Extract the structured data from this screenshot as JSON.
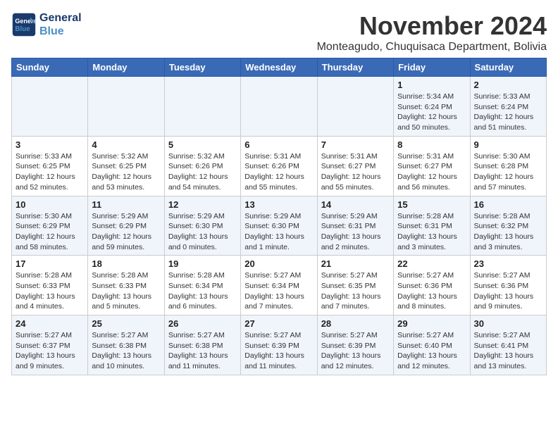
{
  "header": {
    "logo_line1": "General",
    "logo_line2": "Blue",
    "month": "November 2024",
    "location": "Monteagudo, Chuquisaca Department, Bolivia"
  },
  "weekdays": [
    "Sunday",
    "Monday",
    "Tuesday",
    "Wednesday",
    "Thursday",
    "Friday",
    "Saturday"
  ],
  "weeks": [
    [
      {
        "day": "",
        "info": ""
      },
      {
        "day": "",
        "info": ""
      },
      {
        "day": "",
        "info": ""
      },
      {
        "day": "",
        "info": ""
      },
      {
        "day": "",
        "info": ""
      },
      {
        "day": "1",
        "info": "Sunrise: 5:34 AM\nSunset: 6:24 PM\nDaylight: 12 hours and 50 minutes."
      },
      {
        "day": "2",
        "info": "Sunrise: 5:33 AM\nSunset: 6:24 PM\nDaylight: 12 hours and 51 minutes."
      }
    ],
    [
      {
        "day": "3",
        "info": "Sunrise: 5:33 AM\nSunset: 6:25 PM\nDaylight: 12 hours and 52 minutes."
      },
      {
        "day": "4",
        "info": "Sunrise: 5:32 AM\nSunset: 6:25 PM\nDaylight: 12 hours and 53 minutes."
      },
      {
        "day": "5",
        "info": "Sunrise: 5:32 AM\nSunset: 6:26 PM\nDaylight: 12 hours and 54 minutes."
      },
      {
        "day": "6",
        "info": "Sunrise: 5:31 AM\nSunset: 6:26 PM\nDaylight: 12 hours and 55 minutes."
      },
      {
        "day": "7",
        "info": "Sunrise: 5:31 AM\nSunset: 6:27 PM\nDaylight: 12 hours and 55 minutes."
      },
      {
        "day": "8",
        "info": "Sunrise: 5:31 AM\nSunset: 6:27 PM\nDaylight: 12 hours and 56 minutes."
      },
      {
        "day": "9",
        "info": "Sunrise: 5:30 AM\nSunset: 6:28 PM\nDaylight: 12 hours and 57 minutes."
      }
    ],
    [
      {
        "day": "10",
        "info": "Sunrise: 5:30 AM\nSunset: 6:29 PM\nDaylight: 12 hours and 58 minutes."
      },
      {
        "day": "11",
        "info": "Sunrise: 5:29 AM\nSunset: 6:29 PM\nDaylight: 12 hours and 59 minutes."
      },
      {
        "day": "12",
        "info": "Sunrise: 5:29 AM\nSunset: 6:30 PM\nDaylight: 13 hours and 0 minutes."
      },
      {
        "day": "13",
        "info": "Sunrise: 5:29 AM\nSunset: 6:30 PM\nDaylight: 13 hours and 1 minute."
      },
      {
        "day": "14",
        "info": "Sunrise: 5:29 AM\nSunset: 6:31 PM\nDaylight: 13 hours and 2 minutes."
      },
      {
        "day": "15",
        "info": "Sunrise: 5:28 AM\nSunset: 6:31 PM\nDaylight: 13 hours and 3 minutes."
      },
      {
        "day": "16",
        "info": "Sunrise: 5:28 AM\nSunset: 6:32 PM\nDaylight: 13 hours and 3 minutes."
      }
    ],
    [
      {
        "day": "17",
        "info": "Sunrise: 5:28 AM\nSunset: 6:33 PM\nDaylight: 13 hours and 4 minutes."
      },
      {
        "day": "18",
        "info": "Sunrise: 5:28 AM\nSunset: 6:33 PM\nDaylight: 13 hours and 5 minutes."
      },
      {
        "day": "19",
        "info": "Sunrise: 5:28 AM\nSunset: 6:34 PM\nDaylight: 13 hours and 6 minutes."
      },
      {
        "day": "20",
        "info": "Sunrise: 5:27 AM\nSunset: 6:34 PM\nDaylight: 13 hours and 7 minutes."
      },
      {
        "day": "21",
        "info": "Sunrise: 5:27 AM\nSunset: 6:35 PM\nDaylight: 13 hours and 7 minutes."
      },
      {
        "day": "22",
        "info": "Sunrise: 5:27 AM\nSunset: 6:36 PM\nDaylight: 13 hours and 8 minutes."
      },
      {
        "day": "23",
        "info": "Sunrise: 5:27 AM\nSunset: 6:36 PM\nDaylight: 13 hours and 9 minutes."
      }
    ],
    [
      {
        "day": "24",
        "info": "Sunrise: 5:27 AM\nSunset: 6:37 PM\nDaylight: 13 hours and 9 minutes."
      },
      {
        "day": "25",
        "info": "Sunrise: 5:27 AM\nSunset: 6:38 PM\nDaylight: 13 hours and 10 minutes."
      },
      {
        "day": "26",
        "info": "Sunrise: 5:27 AM\nSunset: 6:38 PM\nDaylight: 13 hours and 11 minutes."
      },
      {
        "day": "27",
        "info": "Sunrise: 5:27 AM\nSunset: 6:39 PM\nDaylight: 13 hours and 11 minutes."
      },
      {
        "day": "28",
        "info": "Sunrise: 5:27 AM\nSunset: 6:39 PM\nDaylight: 13 hours and 12 minutes."
      },
      {
        "day": "29",
        "info": "Sunrise: 5:27 AM\nSunset: 6:40 PM\nDaylight: 13 hours and 12 minutes."
      },
      {
        "day": "30",
        "info": "Sunrise: 5:27 AM\nSunset: 6:41 PM\nDaylight: 13 hours and 13 minutes."
      }
    ]
  ]
}
